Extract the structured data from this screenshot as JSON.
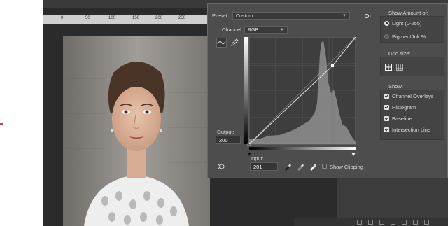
{
  "ruler": {
    "ticks": [
      "0",
      "50",
      "100",
      "150",
      "200",
      "250"
    ]
  },
  "curves": {
    "preset_label": "Preset:",
    "preset_value": "Custom",
    "channel_label": "Channel:",
    "channel_value": "RGB",
    "output_label": "Output:",
    "output_value": "200",
    "input_label": "Input:",
    "input_value": "201",
    "show_clipping_label": "Show Clipping"
  },
  "options": {
    "show_amount_title": "Show Amount of:",
    "light_label": "Light  (0-255)",
    "pigment_label": "Pigment/Ink %",
    "grid_size_title": "Grid size:",
    "show_title": "Show:",
    "show_items": [
      "Channel Overlays",
      "Histogram",
      "Baseline",
      "Intersection Line"
    ]
  },
  "colors": {
    "dialog_bg": "#4d4d4d",
    "panel_bg": "#2b2b2b",
    "accent_text": "#dcdcdc"
  }
}
